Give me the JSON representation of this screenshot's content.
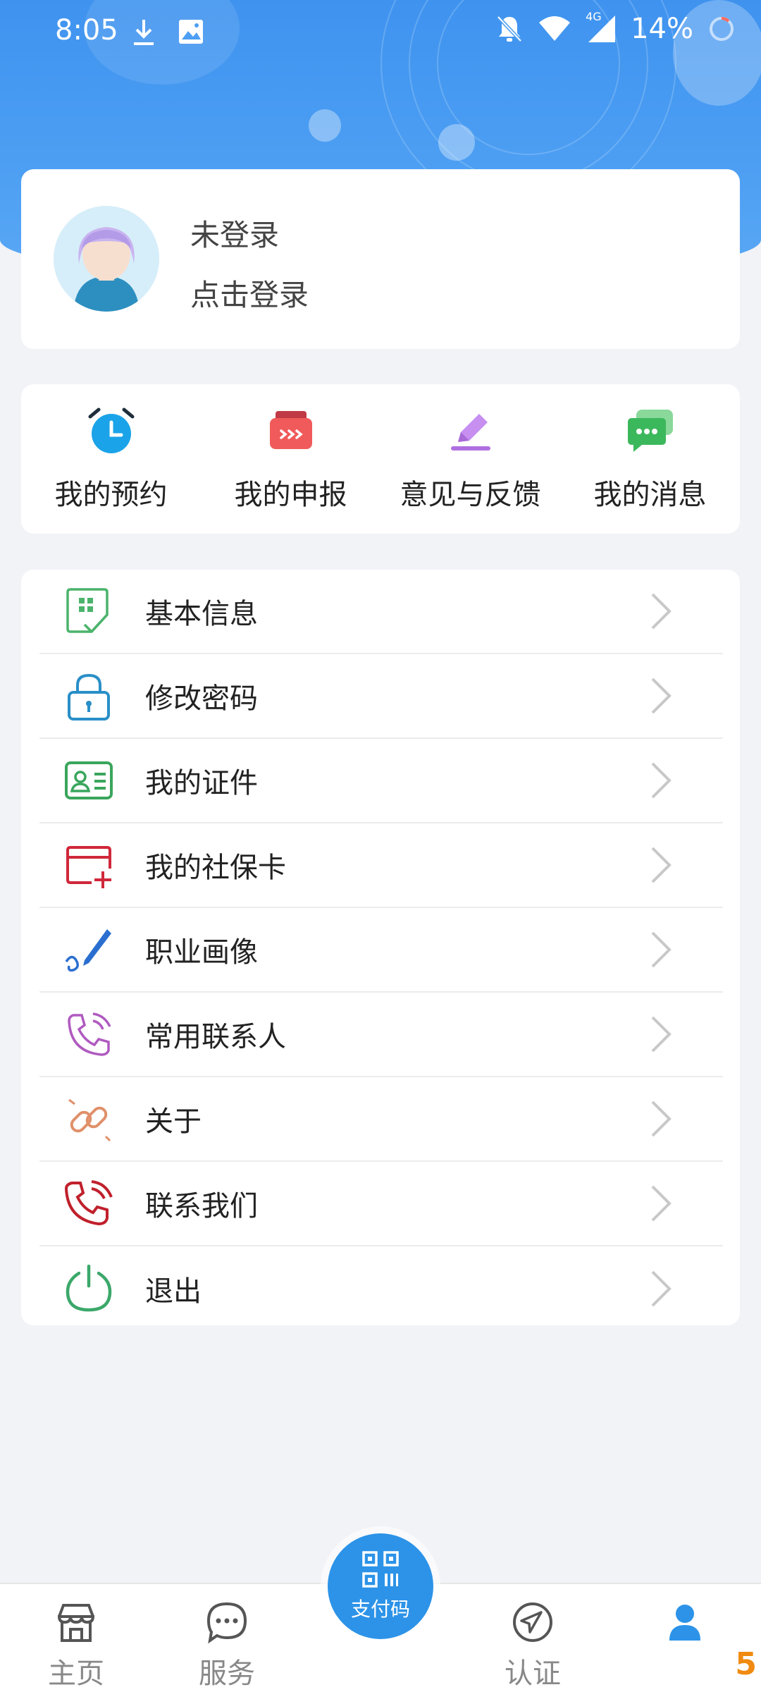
{
  "status_bar": {
    "time": "8:05",
    "network": "4G",
    "battery": "14%",
    "icons": [
      "download-icon",
      "image-icon",
      "bell-off-icon",
      "wifi-icon",
      "signal-icon",
      "battery-icon"
    ]
  },
  "profile": {
    "status": "未登录",
    "action": "点击登录",
    "avatar_icon": "avatar-placeholder"
  },
  "quick_actions": [
    {
      "label": "我的预约",
      "icon": "alarm-clock-icon",
      "color": "#1aa3e8"
    },
    {
      "label": "我的申报",
      "icon": "submit-box-icon",
      "color": "#f05a5a"
    },
    {
      "label": "意见与反馈",
      "icon": "pencil-icon",
      "color": "#b06fe0"
    },
    {
      "label": "我的消息",
      "icon": "chat-icon",
      "color": "#3cb85c"
    }
  ],
  "menu": [
    {
      "label": "基本信息",
      "icon": "info-grid-icon",
      "color": "#4bb36b"
    },
    {
      "label": "修改密码",
      "icon": "lock-icon",
      "color": "#2a8fc8"
    },
    {
      "label": "我的证件",
      "icon": "id-card-icon",
      "color": "#3aa65c"
    },
    {
      "label": "我的社保卡",
      "icon": "card-add-icon",
      "color": "#d0283a"
    },
    {
      "label": "职业画像",
      "icon": "pen-icon",
      "color": "#2a6fd0"
    },
    {
      "label": "常用联系人",
      "icon": "phone-contact-icon",
      "color": "#b05ac0"
    },
    {
      "label": "关于",
      "icon": "link-icon",
      "color": "#e0906a"
    },
    {
      "label": "联系我们",
      "icon": "phone-ring-icon",
      "color": "#c0202c"
    },
    {
      "label": "退出",
      "icon": "power-icon",
      "color": "#3ba86a"
    }
  ],
  "bottom_nav": {
    "items": [
      {
        "label": "主页",
        "icon": "store-icon"
      },
      {
        "label": "服务",
        "icon": "chat-bubble-icon"
      },
      {
        "label": "认证",
        "icon": "navigate-icon"
      },
      {
        "label": "",
        "icon": "user-icon",
        "active": true
      }
    ],
    "fab_label": "支付码",
    "fab_icon": "qr-code-icon"
  },
  "watermark": "5",
  "colors": {
    "primary": "#3f93ef",
    "active_nav": "#2c93e8",
    "background": "#f2f3f7"
  }
}
